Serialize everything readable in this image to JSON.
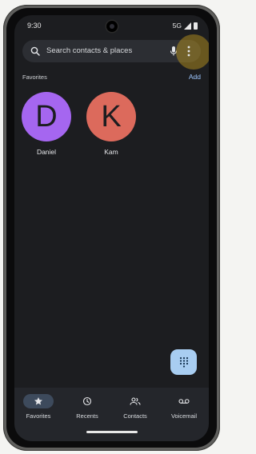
{
  "status_bar": {
    "time": "9:30",
    "network": "5G"
  },
  "search": {
    "placeholder": "Search contacts & places"
  },
  "favorites_section": {
    "title": "Favorites",
    "add_label": "Add",
    "contacts": [
      {
        "name": "Daniel",
        "initial": "D",
        "color": "#a566f0"
      },
      {
        "name": "Kam",
        "initial": "K",
        "color": "#dc6a5c"
      }
    ]
  },
  "bottom_nav": {
    "items": [
      {
        "label": "Favorites",
        "icon": "star-icon",
        "active": true
      },
      {
        "label": "Recents",
        "icon": "clock-icon",
        "active": false
      },
      {
        "label": "Contacts",
        "icon": "people-icon",
        "active": false
      },
      {
        "label": "Voicemail",
        "icon": "voicemail-icon",
        "active": false
      }
    ]
  },
  "colors": {
    "background": "#1c1d20",
    "accent": "#9ec7ff",
    "fab": "#a8cdf1",
    "highlight": "#c8a01e"
  }
}
